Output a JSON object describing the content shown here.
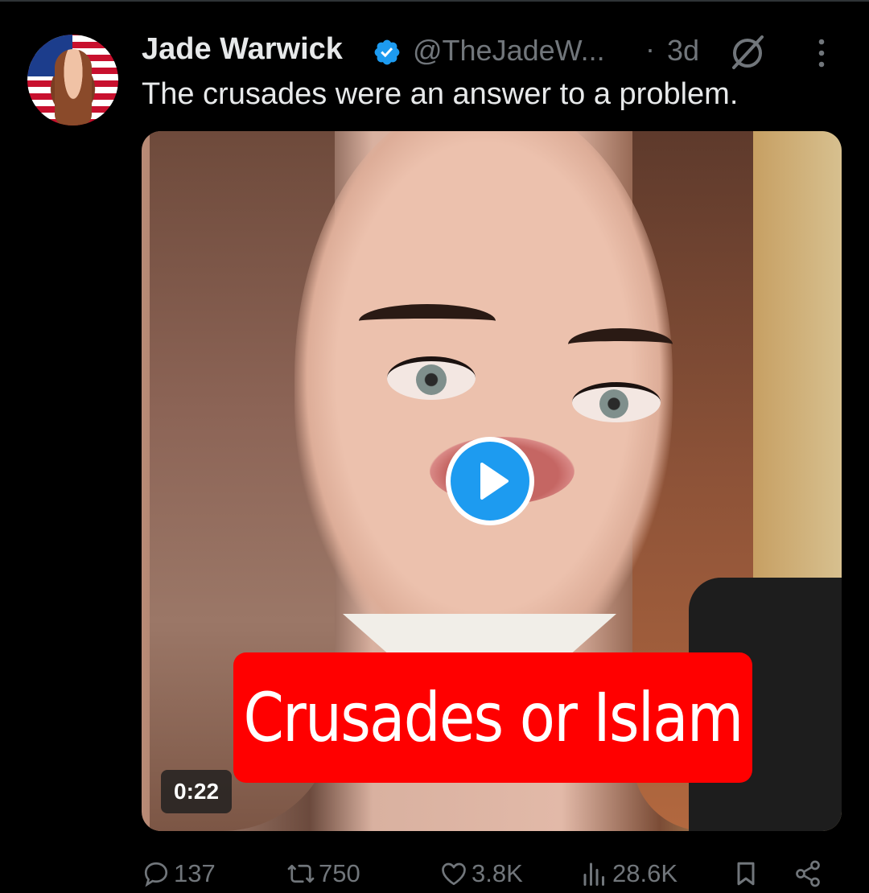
{
  "post": {
    "author": {
      "name": "Jade Warwick",
      "handle": "@TheJadeW...",
      "verified_badge_icon": "verified-badge-icon"
    },
    "separator": "·",
    "time": "3d",
    "text": "The crusades were an answer to a problem.",
    "media": {
      "type": "video",
      "caption": "Crusades or Islam",
      "duration": "0:22",
      "play_icon": "play-icon"
    },
    "actions": {
      "replies": "137",
      "reposts": "750",
      "likes": "3.8K",
      "views": "28.6K"
    }
  },
  "colors": {
    "background": "#000000",
    "text_primary": "#e7e9ea",
    "text_secondary": "#71767b",
    "accent": "#1d9bf0",
    "caption_background": "#ff0000"
  }
}
